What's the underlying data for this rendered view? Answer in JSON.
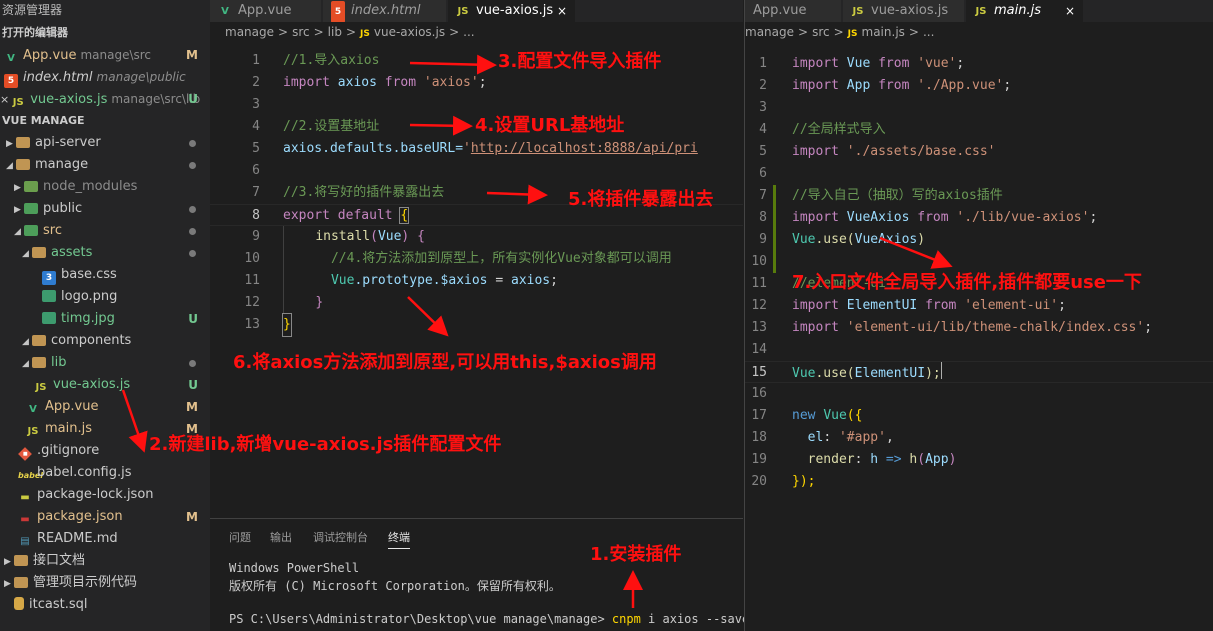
{
  "sidebar": {
    "title": "资源管理器",
    "open_editors_header": "打开的编辑器",
    "open_editors": [
      {
        "name": "App.vue",
        "path": "manage\\src",
        "status": "M",
        "icon": "vue-icon"
      },
      {
        "name": "index.html",
        "path": "manage\\public",
        "status": "",
        "icon": "html-icon"
      },
      {
        "name": "vue-axios.js",
        "path": "manage\\src\\lib",
        "status": "U",
        "icon": "js-icon"
      }
    ],
    "project_header": "VUE MANAGE",
    "tree": [
      {
        "name": "api-server",
        "status": "dot"
      },
      {
        "name": "manage",
        "status": "dot"
      },
      {
        "name": "node_modules",
        "status": ""
      },
      {
        "name": "public",
        "status": "dot"
      },
      {
        "name": "src",
        "status": "dot"
      },
      {
        "name": "assets",
        "status": "dot"
      },
      {
        "name": "base.css",
        "status": ""
      },
      {
        "name": "logo.png",
        "status": ""
      },
      {
        "name": "timg.jpg",
        "status": "U"
      },
      {
        "name": "components",
        "status": ""
      },
      {
        "name": "lib",
        "status": "dot"
      },
      {
        "name": "vue-axios.js",
        "status": "U"
      },
      {
        "name": "App.vue",
        "status": "M"
      },
      {
        "name": "main.js",
        "status": "M"
      },
      {
        "name": ".gitignore",
        "status": ""
      },
      {
        "name": "babel.config.js",
        "status": ""
      },
      {
        "name": "package-lock.json",
        "status": ""
      },
      {
        "name": "package.json",
        "status": "M"
      },
      {
        "name": "README.md",
        "status": ""
      },
      {
        "name": "接口文档",
        "status": ""
      },
      {
        "name": "管理项目示例代码",
        "status": ""
      },
      {
        "name": "itcast.sql",
        "status": ""
      }
    ]
  },
  "left_editor": {
    "tabs": [
      {
        "label": "App.vue",
        "icon": "vue-icon"
      },
      {
        "label": "index.html",
        "icon": "html-icon"
      },
      {
        "label": "vue-axios.js",
        "icon": "js-icon",
        "close": "×"
      }
    ],
    "breadcrumb": [
      "manage",
      ">",
      "src",
      ">",
      "lib",
      ">",
      "JS",
      "vue-axios.js",
      ">",
      "..."
    ],
    "code": {
      "l1": "//1.导入axios",
      "l2_import": "import",
      "l2_axios": "axios",
      "l2_from": "from",
      "l2_str": "'axios'",
      "l2_semi": ";",
      "l4": "//2.设置基地址",
      "l5_obj": "axios",
      "l5_prop": ".defaults.baseURL=",
      "l5_q": "'",
      "l5_url": "http://localhost:8888/api/pri",
      "l7": "//3.将写好的插件暴露出去",
      "l8_export": "export",
      "l8_default": "default",
      "l8_brace": "{",
      "l9_install": "install",
      "l9_paren": "(",
      "l9_vue": "Vue",
      "l9_rest": ") {",
      "l10": "//4.将方法添加到原型上，所有实例化Vue对象都可以调用",
      "l11_vue": "Vue",
      "l11_proto": ".prototype.",
      "l11_axios": "$axios",
      "l11_eq": " = ",
      "l11_val": "axios",
      "l11_semi": ";",
      "l12": "}",
      "l13": "}"
    }
  },
  "right_editor": {
    "tabs": [
      {
        "label": "App.vue"
      },
      {
        "label": "vue-axios.js",
        "icon": "js-icon"
      },
      {
        "label": "main.js",
        "icon": "js-icon",
        "close": "×"
      }
    ],
    "breadcrumb": [
      "manage",
      ">",
      "src",
      ">",
      "JS",
      "main.js",
      ">",
      "..."
    ],
    "code": {
      "l1_import": "import",
      "l1_name": "Vue",
      "l1_from": "from",
      "l1_str": "'vue'",
      "l1_semi": ";",
      "l2_import": "import",
      "l2_name": "App",
      "l2_from": "from",
      "l2_str": "'./App.vue'",
      "l2_semi": ";",
      "l4": "//全局样式导入",
      "l5_import": "import",
      "l5_str": "'./assets/base.css'",
      "l7": "//导入自己（抽取）写的axios插件",
      "l8_import": "import",
      "l8_name": "VueAxios",
      "l8_from": "from",
      "l8_str": "'./lib/vue-axios'",
      "l8_semi": ";",
      "l9_vue": "Vue",
      "l9_use": ".use(",
      "l9_arg": "VueAxios",
      "l9_close": ")",
      "l11": "//element-ui",
      "l12_import": "import",
      "l12_name": "ElementUI",
      "l12_from": "from",
      "l12_str": "'element-ui'",
      "l12_semi": ";",
      "l13_import": "import",
      "l13_str": "'element-ui/lib/theme-chalk/index.css'",
      "l13_semi": ";",
      "l15_vue": "Vue",
      "l15_use": ".use(",
      "l15_arg": "ElementUI",
      "l15_close": ");",
      "l17_new": "new",
      "l17_vue": "Vue",
      "l17_open": "({",
      "l18_key": "el",
      "l18_colon": ": ",
      "l18_str": "'#app'",
      "l18_comma": ",",
      "l19_key": "render",
      "l19_colon": ": ",
      "l19_h": "h",
      "l19_arrow": " => ",
      "l19_fn": "h",
      "l19_open": "(",
      "l19_app": "App",
      "l19_close": ")",
      "l20": "});"
    }
  },
  "panel": {
    "tabs": [
      "问题",
      "输出",
      "调试控制台",
      "终端"
    ],
    "active_tab": "终端",
    "lines": [
      "Windows PowerShell",
      "版权所有 (C) Microsoft Corporation。保留所有权利。"
    ],
    "prompt": "PS C:\\Users\\Administrator\\Desktop\\vue manage\\manage>",
    "cmd": "cnpm",
    "args": " i axios --save"
  },
  "annotations": {
    "n1": "1.安装插件",
    "n2": "2.新建lib,新增vue-axios.js插件配置文件",
    "n3": "3.配置文件导入插件",
    "n4": "4.设置URL基地址",
    "n5": "5.将插件暴露出去",
    "n6": "6.将axios方法添加到原型,可以用this,$axios调用",
    "n7": "7.入口文件全局导入插件,插件都要use一下"
  },
  "colors": {
    "annotation": "#ff1010",
    "modified": "#e2c08d",
    "untracked": "#73c991",
    "keyword": "#c586c0",
    "string": "#ce9178",
    "comment": "#6a9955"
  }
}
